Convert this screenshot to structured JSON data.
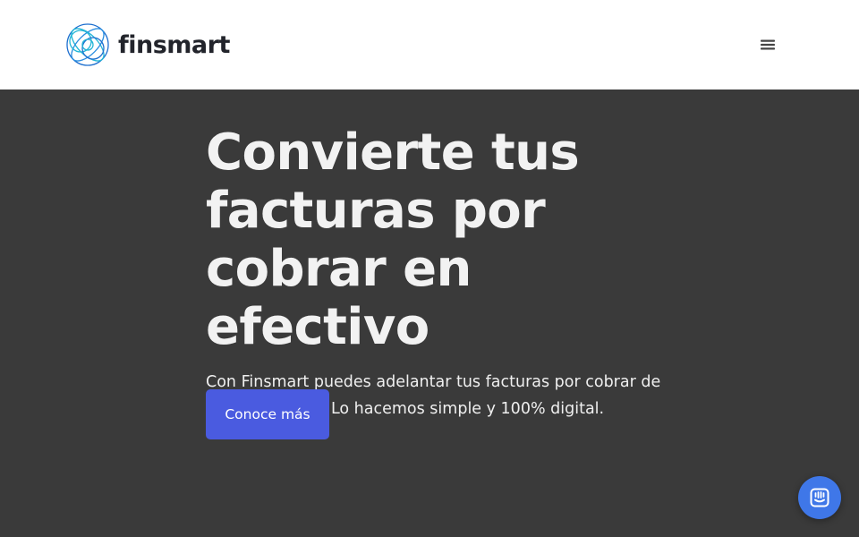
{
  "header": {
    "brand_name": "finsmart",
    "menu_icon": "hamburger-menu-icon"
  },
  "hero": {
    "title": "Convierte tus facturas por cobrar en efectivo",
    "subtitle": "Con Finsmart puedes adelantar tus facturas por cobrar de manera rápida. Lo hacemos simple y 100% digital.",
    "cta_label": "Conoce más"
  },
  "chat": {
    "icon": "chat-icon"
  },
  "colors": {
    "hero_background": "#3a3a3a",
    "header_background": "#ffffff",
    "cta_background": "#4a5be0",
    "chat_launcher": "#3f77e8",
    "logo_blue": "#1e7fd6",
    "logo_teal": "#22b5d6"
  }
}
